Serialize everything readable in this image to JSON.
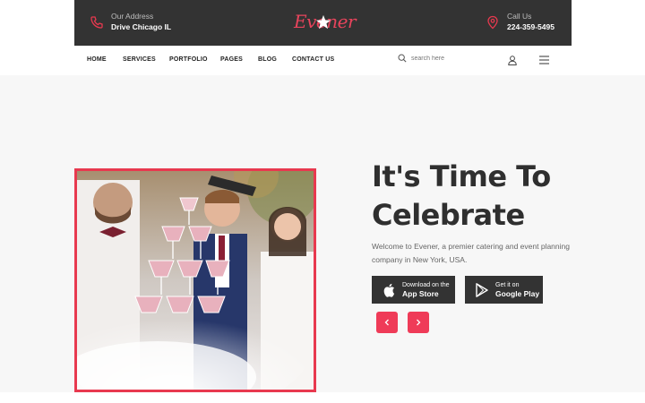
{
  "topbar": {
    "address_label": "Our Address",
    "address_value": "Drive Chicago IL",
    "logo_text": "Evener",
    "call_label": "Call Us",
    "call_value": "224-359-5495"
  },
  "nav": {
    "items": [
      {
        "label": "HOME"
      },
      {
        "label": "SERVICES"
      },
      {
        "label": "PORTFOLIO"
      },
      {
        "label": "PAGES"
      },
      {
        "label": "BLOG"
      },
      {
        "label": "CONTACT US"
      }
    ],
    "search_placeholder": "search here"
  },
  "hero": {
    "headline_line1": "It's Time To",
    "headline_line2": "Celebrate",
    "description": "Welcome to Evener, a premier catering and event planning company in New York, USA.",
    "appstore_small": "Download on the",
    "appstore_big": "App Store",
    "gplay_small": "Get it on",
    "gplay_big": "Google Play"
  },
  "colors": {
    "accent": "#e8394f",
    "dark": "#333333",
    "hero_bg": "#f7f7f7"
  },
  "icons": {
    "address": "phone-icon",
    "call": "map-pin-icon",
    "search": "search-icon",
    "user": "user-icon",
    "menu": "hamburger-icon",
    "prev": "chevron-left-icon",
    "next": "chevron-right-icon"
  }
}
